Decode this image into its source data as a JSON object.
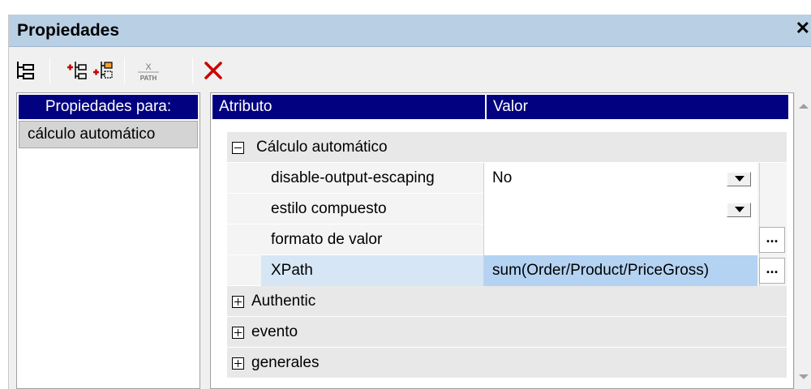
{
  "window": {
    "title": "Propiedades",
    "close_glyph": "✕"
  },
  "toolbar": {
    "buttons": [
      {
        "icon": "tree-layout-icon"
      },
      {
        "icon": "add-before-icon"
      },
      {
        "icon": "add-after-icon"
      },
      {
        "icon": "xpath-icon",
        "label": "PATH"
      },
      {
        "icon": "delete-icon"
      }
    ]
  },
  "left_panel": {
    "header": "Propiedades para:",
    "items": [
      "cálculo automático"
    ]
  },
  "grid": {
    "columns": [
      "Atributo",
      "Valor"
    ],
    "group_calc": {
      "label": "Cálculo automático",
      "expanded": true,
      "rows": [
        {
          "attribute": "disable-output-escaping",
          "value": "No",
          "control": "dropdown"
        },
        {
          "attribute": "estilo compuesto",
          "value": "",
          "control": "dropdown"
        },
        {
          "attribute": "formato de valor",
          "value": "",
          "control": "ellipsis"
        },
        {
          "attribute": "XPath",
          "value": "sum(Order/Product/PriceGross)",
          "control": "ellipsis",
          "selected": true
        }
      ]
    },
    "groups": [
      "Authentic",
      "evento",
      "generales"
    ],
    "ellipsis_label": "..."
  },
  "colors": {
    "header_bg": "#020280",
    "titlebar_bg": "#b9cfe4",
    "selected_value_bg": "#b4d3f2",
    "delete_red": "#cc0000"
  }
}
